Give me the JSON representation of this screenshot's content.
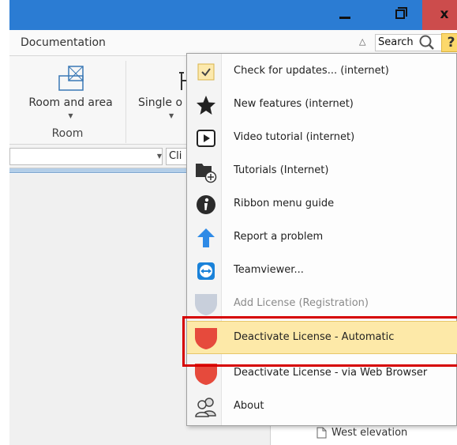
{
  "titlebar": {
    "accent": "#2b7cd3",
    "close_color": "#cc4c4c",
    "close_glyph": "x"
  },
  "ribbon": {
    "tabs": [
      {
        "label": "Documentation"
      }
    ],
    "search": {
      "value": "Search"
    },
    "help_label": "?",
    "groups": [
      {
        "label": "Room",
        "buttons": [
          {
            "label": "Room and area",
            "icon": "room-plan-icon"
          }
        ]
      },
      {
        "label": "",
        "buttons": [
          {
            "label": "Single o",
            "icon": "chair-icon"
          }
        ]
      }
    ]
  },
  "toolbar": {
    "combo2_value": "Cli"
  },
  "help_menu": {
    "items": [
      {
        "label": "Check for updates... (internet)",
        "icon": "checkmark-icon",
        "enabled": true
      },
      {
        "label": "New features (internet)",
        "icon": "star-icon",
        "enabled": true
      },
      {
        "label": "Video tutorial (internet)",
        "icon": "video-play-icon",
        "enabled": true
      },
      {
        "label": "Tutorials (Internet)",
        "icon": "tutorial-folder-icon",
        "enabled": true
      },
      {
        "label": "Ribbon menu guide",
        "icon": "info-icon",
        "enabled": true
      },
      {
        "label": "Report a problem",
        "icon": "arrow-up-icon",
        "enabled": true
      },
      {
        "label": "Teamviewer...",
        "icon": "teamviewer-icon",
        "enabled": true
      },
      {
        "label": "Add License (Registration)",
        "icon": "shield-gray-icon",
        "enabled": false
      },
      {
        "label": "Deactivate License - Automatic",
        "icon": "shield-red-icon",
        "enabled": true,
        "highlighted": true
      },
      {
        "label": "Deactivate License - via Web Browser",
        "icon": "shield-red-icon",
        "enabled": true
      },
      {
        "label": "About",
        "icon": "users-icon",
        "enabled": true
      }
    ],
    "highlight_color": "#fde9a8",
    "annotation_color": "#d60000"
  },
  "tree": {
    "items": [
      {
        "label": "West elevation",
        "icon": "document-icon"
      }
    ]
  }
}
